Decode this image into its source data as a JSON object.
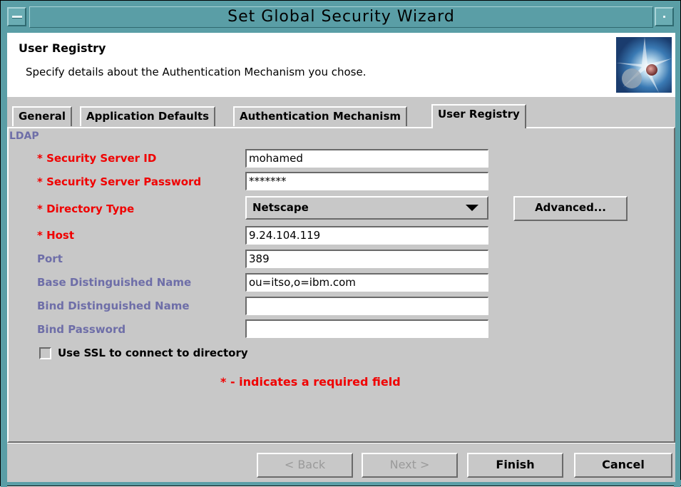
{
  "window": {
    "title": "Set Global Security Wizard",
    "title_bg": "#5a9ea6"
  },
  "header": {
    "title": "User Registry",
    "description": "Specify details about the Authentication Mechanism you chose.",
    "image_icon": "globe-graphic"
  },
  "tabs": [
    {
      "label": "General",
      "active": false
    },
    {
      "label": "Application Defaults",
      "active": false
    },
    {
      "label": "Authentication Mechanism",
      "active": false
    },
    {
      "label": "User Registry",
      "active": true
    }
  ],
  "group_label": "LDAP",
  "fields": {
    "server_id": {
      "label": "* Security Server ID",
      "value": "mohamed",
      "required": true
    },
    "server_password": {
      "label": "* Security Server Password",
      "value": "*******",
      "required": true
    },
    "directory_type": {
      "label": "* Directory Type",
      "value": "Netscape",
      "required": true
    },
    "host": {
      "label": "* Host",
      "value": "9.24.104.119",
      "required": true
    },
    "port": {
      "label": "Port",
      "value": "389",
      "required": false
    },
    "base_dn": {
      "label": "Base Distinguished Name",
      "value": "ou=itso,o=ibm.com",
      "required": false
    },
    "bind_dn": {
      "label": "Bind Distinguished Name",
      "value": "",
      "required": false
    },
    "bind_password": {
      "label": "Bind Password",
      "value": "",
      "required": false
    }
  },
  "advanced_button": "Advanced...",
  "ssl_checkbox": {
    "label": "Use SSL to connect to directory",
    "checked": false
  },
  "required_note": "* - indicates a required field",
  "footer": {
    "back": "< Back",
    "next": "Next >",
    "finish": "Finish",
    "cancel": "Cancel"
  },
  "colors": {
    "required_label": "#f00000",
    "optional_label": "#6e6ea8",
    "panel_bg": "#c8c8c8"
  }
}
